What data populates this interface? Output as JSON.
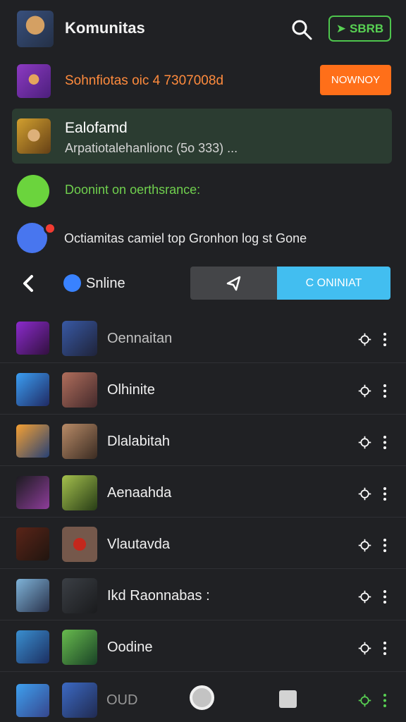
{
  "header": {
    "title": "Komunitas",
    "share_label": "SBRB"
  },
  "promo": {
    "text": "Sohnfiotas oic 4 7307008d",
    "button_label": "NOWNOY"
  },
  "active_card": {
    "name": "Ealofamd",
    "description": "Arpatiotalehanlionc (5o 333) ..."
  },
  "status": {
    "text": "Doonint on oerthsrance:"
  },
  "notice": {
    "text": "Octiamitas camiel top Gronhon log st Gone"
  },
  "tabs": {
    "online_label": "Snline",
    "right_tab_label": "C ONINIAT"
  },
  "members": [
    {
      "name": "Oennaitan"
    },
    {
      "name": "Olhinite"
    },
    {
      "name": "Dlalabitah"
    },
    {
      "name": "Aenaahda"
    },
    {
      "name": "Vlautavda"
    },
    {
      "name": "Ikd Raonnabas :"
    },
    {
      "name": "Oodine"
    }
  ],
  "bottom": {
    "name": "OUD"
  },
  "colors": {
    "accent_green": "#58d153",
    "accent_orange": "#ff6f19",
    "accent_blue": "#42bef0"
  }
}
